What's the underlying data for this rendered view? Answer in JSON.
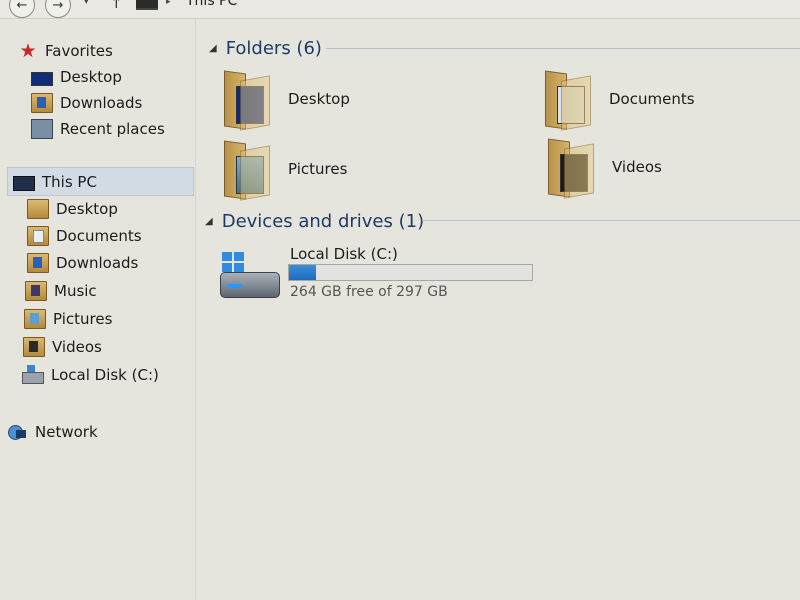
{
  "address": {
    "location": "This PC"
  },
  "nav": {
    "back_glyph": "←",
    "forward_glyph": "→",
    "recent_glyph": "▾",
    "up_glyph": "↑",
    "separator_glyph": "▸"
  },
  "sidebar": {
    "favorites": {
      "label": "Favorites",
      "icon": "star-icon"
    },
    "favorites_items": [
      {
        "label": "Desktop",
        "icon": "desktop-icon"
      },
      {
        "label": "Downloads",
        "icon": "downloads-folder-icon"
      },
      {
        "label": "Recent places",
        "icon": "recent-places-icon"
      }
    ],
    "this_pc": {
      "label": "This PC",
      "icon": "computer-icon",
      "selected": true
    },
    "this_pc_items": [
      {
        "label": "Desktop",
        "icon": "desktop-folder-icon"
      },
      {
        "label": "Documents",
        "icon": "documents-folder-icon"
      },
      {
        "label": "Downloads",
        "icon": "downloads-folder-icon"
      },
      {
        "label": "Music",
        "icon": "music-folder-icon"
      },
      {
        "label": "Pictures",
        "icon": "pictures-folder-icon"
      },
      {
        "label": "Videos",
        "icon": "videos-folder-icon"
      },
      {
        "label": "Local Disk (C:)",
        "icon": "local-disk-icon"
      }
    ],
    "network": {
      "label": "Network",
      "icon": "network-icon"
    }
  },
  "content": {
    "folders_header": "Folders (6)",
    "folders": [
      {
        "label": "Desktop",
        "icon": "desktop-folder-icon"
      },
      {
        "label": "Documents",
        "icon": "documents-folder-icon"
      },
      {
        "label": "Pictures",
        "icon": "pictures-folder-icon"
      },
      {
        "label": "Videos",
        "icon": "videos-folder-icon"
      }
    ],
    "devices_header": "Devices and drives (1)",
    "drive": {
      "name": "Local Disk (C:)",
      "free_text": "264 GB free of 297 GB",
      "used_fraction": 0.111,
      "bar_color": "#1d6bbd"
    }
  },
  "colors": {
    "background": "#e6e5dd",
    "selection": "#d3dbe4",
    "header_text": "#1e3a66"
  }
}
